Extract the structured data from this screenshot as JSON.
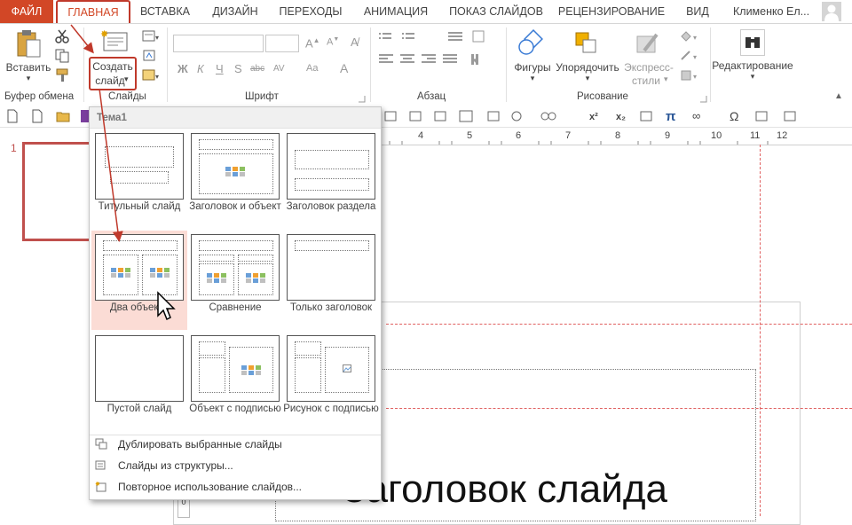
{
  "tabs": {
    "file": "ФАЙЛ",
    "home": "ГЛАВНАЯ",
    "insert": "ВСТАВКА",
    "design": "ДИЗАЙН",
    "transitions": "ПЕРЕХОДЫ",
    "animation": "АНИМАЦИЯ",
    "slideshow": "ПОКАЗ СЛАЙДОВ",
    "review": "РЕЦЕНЗИРОВАНИЕ",
    "view": "ВИД"
  },
  "user": {
    "name": "Клименко Ел..."
  },
  "ribbon": {
    "clipboard": {
      "paste_label": "Вставить",
      "group_label": "Буфер обмена"
    },
    "slides": {
      "new_slide_line1": "Создать",
      "new_slide_line2": "слайд",
      "group_label": "Слайды"
    },
    "font": {
      "group_label": "Шрифт",
      "bold": "Ж",
      "italic": "К",
      "underline": "Ч",
      "strike": "S",
      "shadow": "abc",
      "spacing": "AV",
      "case": "Aa",
      "font_color": "A"
    },
    "paragraph": {
      "group_label": "Абзац"
    },
    "drawing": {
      "shapes": "Фигуры",
      "arrange": "Упорядочить",
      "quick_styles_line1": "Экспресс-",
      "quick_styles_line2": "стили",
      "group_label": "Рисование"
    },
    "editing": {
      "label": "Редактирование"
    }
  },
  "ruler": {
    "ticks": [
      "4",
      "5",
      "6",
      "7",
      "8",
      "9",
      "10",
      "11",
      "12"
    ]
  },
  "thumbnail": {
    "number": "1"
  },
  "slide": {
    "title": "Заголовок слайда"
  },
  "gallery": {
    "header": "Тема1",
    "layouts": [
      {
        "name": "Титульный слайд"
      },
      {
        "name": "Заголовок и объект"
      },
      {
        "name": "Заголовок раздела"
      },
      {
        "name": "Два объекта"
      },
      {
        "name": "Сравнение"
      },
      {
        "name": "Только заголовок"
      },
      {
        "name": "Пустой слайд"
      },
      {
        "name": "Объект с подписью"
      },
      {
        "name": "Рисунок с подписью"
      }
    ],
    "menu": [
      {
        "label": "Дублировать выбранные слайды"
      },
      {
        "label": "Слайды из структуры..."
      },
      {
        "label": "Повторное использование слайдов..."
      }
    ]
  },
  "colors": {
    "accent": "#d24726",
    "annotation": "#c0392b",
    "highlight": "#fbdcd5"
  }
}
